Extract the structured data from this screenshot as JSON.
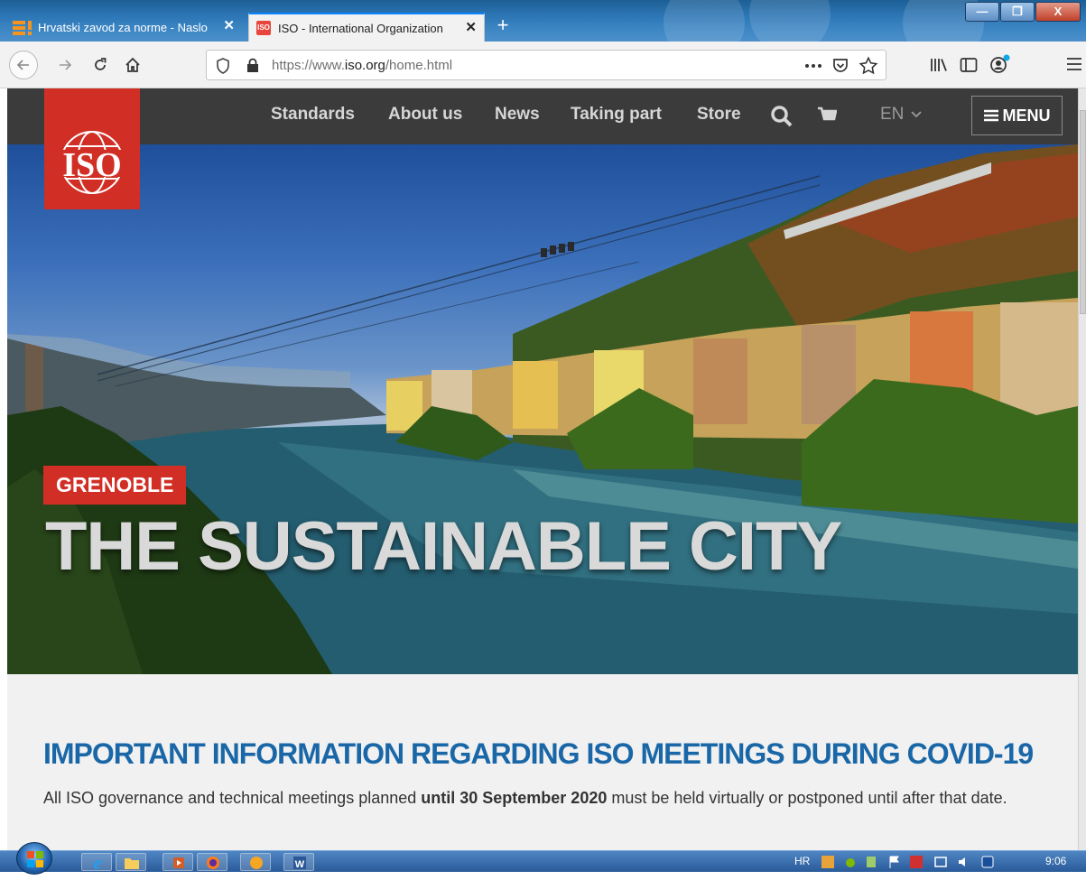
{
  "browser": {
    "tabs": [
      {
        "title": "Hrvatski zavod za norme - Naslo",
        "active": false
      },
      {
        "title": "ISO - International Organization",
        "active": true
      }
    ],
    "close_glyph": "✕",
    "new_tab_glyph": "+",
    "url": {
      "prefix": "https://www.",
      "domain": "iso.org",
      "path": "/home.html"
    },
    "window_buttons": {
      "minimize": "—",
      "maximize": "❐",
      "close": "X"
    },
    "icons": [
      "back-arrow-icon",
      "forward-arrow-icon",
      "reload-icon",
      "home-icon",
      "shield-icon",
      "lock-icon",
      "more-icon",
      "pocket-icon",
      "star-icon",
      "library-icon",
      "sidebar-icon",
      "account-icon",
      "hamburger-icon"
    ]
  },
  "site": {
    "logo": "ISO",
    "nav": [
      "Standards",
      "About us",
      "News",
      "Taking part",
      "Store"
    ],
    "language": "EN",
    "menu_label": "MENU",
    "colors": {
      "brand_red": "#d12f25",
      "header_bg": "#3b3b3b",
      "heading_blue": "#1a67a8"
    }
  },
  "hero": {
    "badge": "GRENOBLE",
    "title": "THE SUSTAINABLE CITY"
  },
  "notice": {
    "heading": "IMPORTANT INFORMATION REGARDING ISO MEETINGS DURING COVID-19",
    "text_before": "All ISO governance and technical meetings planned ",
    "text_bold": "until 30 September 2020",
    "text_after": " must be held virtually or postponed until after that date."
  },
  "taskbar": {
    "language": "HR",
    "clock": "9:06"
  }
}
